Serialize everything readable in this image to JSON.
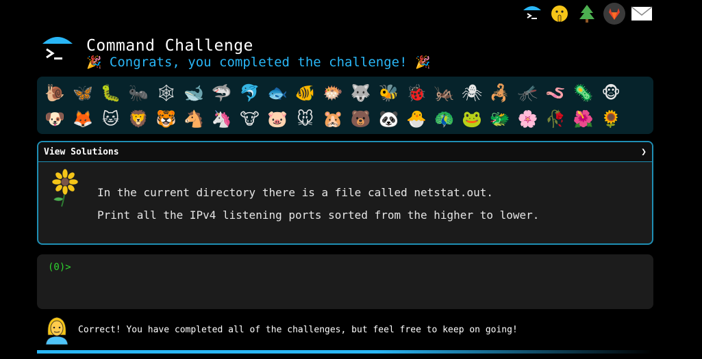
{
  "header": {
    "title": "Command Challenge",
    "subtitle_text": "Congrats, you completed the challenge!",
    "party_emoji": "🎉",
    "icons": [
      "terminal-umbrella-icon",
      "shushing-face-icon",
      "tree-icon",
      "gitlab-icon",
      "envelope-icon"
    ]
  },
  "emoji_bar": {
    "items": [
      {
        "glyph": "🐌",
        "name": "snail"
      },
      {
        "glyph": "🦋",
        "name": "butterfly"
      },
      {
        "glyph": "🐛",
        "name": "caterpillar"
      },
      {
        "glyph": "🐜",
        "name": "ant"
      },
      {
        "glyph": "🕸",
        "name": "spider-web"
      },
      {
        "glyph": "🐋",
        "name": "whale"
      },
      {
        "glyph": "🦈",
        "name": "shark"
      },
      {
        "glyph": "🐬",
        "name": "dolphin"
      },
      {
        "glyph": "🐟",
        "name": "fish"
      },
      {
        "glyph": "🐠",
        "name": "tropical-fish"
      },
      {
        "glyph": "🐡",
        "name": "blowfish"
      },
      {
        "glyph": "🐺",
        "name": "wolf"
      },
      {
        "glyph": "🐝",
        "name": "bee"
      },
      {
        "glyph": "🐞",
        "name": "ladybug"
      },
      {
        "glyph": "🦗",
        "name": "cricket"
      },
      {
        "glyph": "🕷",
        "name": "spider"
      },
      {
        "glyph": "🦂",
        "name": "scorpion"
      },
      {
        "glyph": "🦟",
        "name": "fly"
      },
      {
        "glyph": "🪱",
        "name": "worm"
      },
      {
        "glyph": "🦠",
        "name": "microbe"
      },
      {
        "glyph": "🐵",
        "name": "monkey"
      },
      {
        "glyph": "🐶",
        "name": "dog"
      },
      {
        "glyph": "🦊",
        "name": "fox"
      },
      {
        "glyph": "🐱",
        "name": "cat"
      },
      {
        "glyph": "🦁",
        "name": "lion"
      },
      {
        "glyph": "🐯",
        "name": "tiger"
      },
      {
        "glyph": "🐴",
        "name": "horse"
      },
      {
        "glyph": "🦄",
        "name": "unicorn"
      },
      {
        "glyph": "🐮",
        "name": "cow"
      },
      {
        "glyph": "🐷",
        "name": "pig"
      },
      {
        "glyph": "🐭",
        "name": "mouse"
      },
      {
        "glyph": "🐹",
        "name": "hamster"
      },
      {
        "glyph": "🐻",
        "name": "bear"
      },
      {
        "glyph": "🐼",
        "name": "panda"
      },
      {
        "glyph": "🐣",
        "name": "hatching-chick"
      },
      {
        "glyph": "🦚",
        "name": "peacock"
      },
      {
        "glyph": "🐸",
        "name": "frog"
      },
      {
        "glyph": "🐲",
        "name": "dragon"
      },
      {
        "glyph": "🌸",
        "name": "cherry-blossom"
      },
      {
        "glyph": "🥀",
        "name": "wilted-flower"
      },
      {
        "glyph": "🌺",
        "name": "hibiscus"
      },
      {
        "glyph": "🌻",
        "name": "sunflower"
      }
    ]
  },
  "solutions_panel": {
    "header": "View Solutions",
    "chevron": "❯",
    "icon": "sunflower-icon",
    "line1": "In the current directory there is a file called netstat.out.",
    "line2": "Print all the IPv4 listening ports sorted from the higher to lower."
  },
  "terminal": {
    "prompt": "(0)>"
  },
  "status": {
    "avatar_icon": "woman-avatar-icon",
    "message": "Correct! You have completed all of the challenges, but feel free to keep on going!"
  },
  "colors": {
    "accent": "#29b6f6",
    "prompt": "#2fd62f",
    "panel_border": "#1f8fb5",
    "emoji_bar_bg": "#06232b"
  }
}
